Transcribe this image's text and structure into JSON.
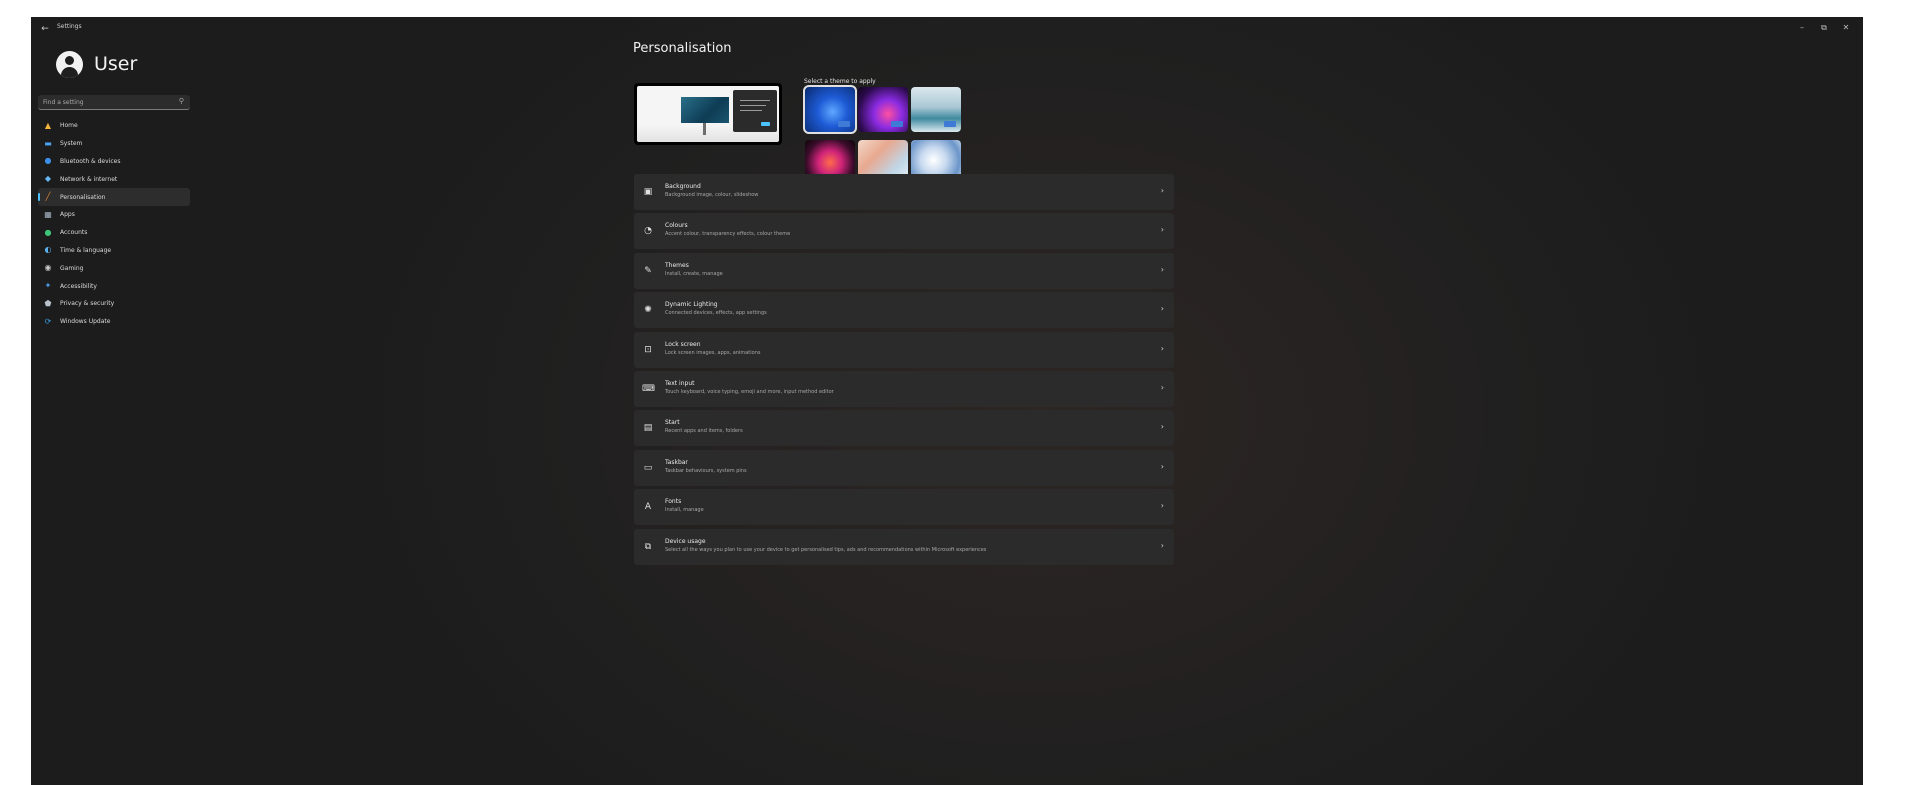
{
  "window": {
    "title": "Settings",
    "back_glyph": "←",
    "minimize_glyph": "–",
    "maximize_glyph": "⧉",
    "close_glyph": "✕"
  },
  "user": {
    "name": "User"
  },
  "search": {
    "placeholder": "Find a setting",
    "icon": "search-icon"
  },
  "sidebar": {
    "items": [
      {
        "label": "Home",
        "icon": "home-icon",
        "color": "#f4b43a",
        "glyph": "▲"
      },
      {
        "label": "System",
        "icon": "system-icon",
        "color": "#4aa3f0",
        "glyph": "▬"
      },
      {
        "label": "Bluetooth & devices",
        "icon": "bluetooth-icon",
        "color": "#3d8ee8",
        "glyph": "●"
      },
      {
        "label": "Network & internet",
        "icon": "network-icon",
        "color": "#66b8f5",
        "glyph": "◆"
      },
      {
        "label": "Personalisation",
        "icon": "brush-icon",
        "color": "#e88a3a",
        "glyph": "╱"
      },
      {
        "label": "Apps",
        "icon": "apps-icon",
        "color": "#a7b5c6",
        "glyph": "▦"
      },
      {
        "label": "Accounts",
        "icon": "accounts-icon",
        "color": "#3fc57a",
        "glyph": "●"
      },
      {
        "label": "Time & language",
        "icon": "globe-clock-icon",
        "color": "#5ab0f0",
        "glyph": "◐"
      },
      {
        "label": "Gaming",
        "icon": "gaming-icon",
        "color": "#c9c9c9",
        "glyph": "◉"
      },
      {
        "label": "Accessibility",
        "icon": "accessibility-icon",
        "color": "#4a9eea",
        "glyph": "✦"
      },
      {
        "label": "Privacy & security",
        "icon": "shield-icon",
        "color": "#b9c2cc",
        "glyph": "⬟"
      },
      {
        "label": "Windows Update",
        "icon": "windows-update-icon",
        "color": "#3a9ee8",
        "glyph": "⟳"
      }
    ],
    "selected_index": 4,
    "accent": "#4cc2ff"
  },
  "main": {
    "title": "Personalisation",
    "themes_label": "Select a theme to apply",
    "themes": [
      {
        "name": "windows-light-bloom",
        "bg": "radial-gradient(circle at 55% 55%, #5fa8ff 0%, #1e5bd6 40%, #0a2a6e 100%)",
        "selected": true
      },
      {
        "name": "windows-dark-glow",
        "bg": "radial-gradient(circle at 60% 60%, #ff4fa0 0%, #8a2be2 35%, #2a0a4a 75%, #12051f 100%)",
        "selected": false
      },
      {
        "name": "captured-motion",
        "bg": "linear-gradient(180deg, #dce8ee 0%, #a9c7d4 45%, #3f8aa0 70%, #dbe9ee 100%)",
        "selected": false
      },
      {
        "name": "glow",
        "bg": "radial-gradient(circle at 50% 50%, #ff6b4a 0%, #d0247a 35%, #3a0c2a 70%, #0c0508 100%)",
        "selected": false
      },
      {
        "name": "flow",
        "bg": "linear-gradient(135deg, #f3d9c8 0%, #e8a890 35%, #bfd7e8 70%, #f0f4f8 100%)",
        "selected": false
      },
      {
        "name": "sunrise",
        "bg": "radial-gradient(circle at 45% 45%, #ffffff 0%, #c7d9ef 35%, #6b95c9 70%, #dfe8f3 100%)",
        "selected": false
      }
    ],
    "settings": [
      {
        "title": "Background",
        "desc": "Background image, colour, slideshow",
        "icon": "background-image-icon",
        "glyph": "▣"
      },
      {
        "title": "Colours",
        "desc": "Accent colour, transparency effects, colour theme",
        "icon": "palette-icon",
        "glyph": "◔"
      },
      {
        "title": "Themes",
        "desc": "Install, create, manage",
        "icon": "brush-icon",
        "glyph": "✎"
      },
      {
        "title": "Dynamic Lighting",
        "desc": "Connected devices, effects, app settings",
        "icon": "lighting-icon",
        "glyph": "✺"
      },
      {
        "title": "Lock screen",
        "desc": "Lock screen images, apps, animations",
        "icon": "lock-screen-icon",
        "glyph": "⊡"
      },
      {
        "title": "Text input",
        "desc": "Touch keyboard, voice typing, emoji and more, input method editor",
        "icon": "keyboard-icon",
        "glyph": "⌨"
      },
      {
        "title": "Start",
        "desc": "Recent apps and items, folders",
        "icon": "start-menu-icon",
        "glyph": "▤"
      },
      {
        "title": "Taskbar",
        "desc": "Taskbar behaviours, system pins",
        "icon": "taskbar-icon",
        "glyph": "▭"
      },
      {
        "title": "Fonts",
        "desc": "Install, manage",
        "icon": "fonts-icon",
        "glyph": "A"
      },
      {
        "title": "Device usage",
        "desc": "Select all the ways you plan to use your device to get personalised tips, ads and recommendations within Microsoft experiences",
        "icon": "device-usage-icon",
        "glyph": "⧉"
      }
    ],
    "chevron_glyph": "›"
  }
}
